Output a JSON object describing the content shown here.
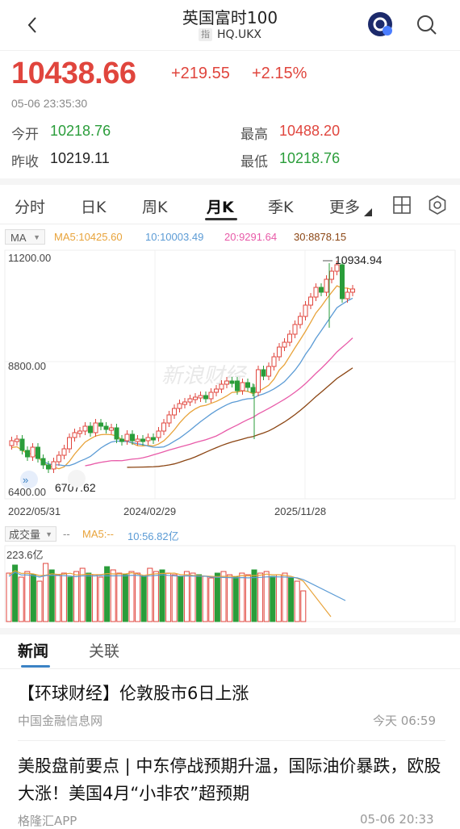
{
  "header": {
    "title": "英国富时100",
    "tag": "指",
    "code": "HQ.UKX"
  },
  "quote": {
    "price": "10438.66",
    "change": "+219.55",
    "change_pct": "+2.15%",
    "time": "05-06 23:35:30",
    "open_label": "今开",
    "open": "10218.76",
    "high_label": "最高",
    "high": "10488.20",
    "prev_label": "昨收",
    "prev": "10219.11",
    "low_label": "最低",
    "low": "10218.76"
  },
  "tabs": [
    "分时",
    "日K",
    "周K",
    "月K",
    "季K",
    "更多"
  ],
  "active_tab": "月K",
  "ma": {
    "button": "MA",
    "ma5": "MA5:10425.60",
    "ma10": "10:10003.49",
    "ma20": "20:9291.64",
    "ma30": "30:8878.15"
  },
  "chart_data": {
    "type": "candlestick",
    "y_ticks": [
      "11200.00",
      "8800.00",
      "6400.00"
    ],
    "x_ticks": [
      "2022/05/31",
      "2024/02/29",
      "2025/11/28"
    ],
    "max_label": "10934.94",
    "min_label": "6707.62",
    "watermark": "新浪财经",
    "ylim": [
      6400,
      11200
    ],
    "colors": {
      "up": "#e0453d",
      "down": "#2a9d3a",
      "ma5": "#e8a33a",
      "ma10": "#5b9bd5",
      "ma20": "#e85aa8",
      "ma30": "#8b4513"
    }
  },
  "volume": {
    "button": "成交量",
    "dash": "--",
    "ma5": "MA5:--",
    "ma10": "10:56.82亿",
    "max_label": "223.6亿"
  },
  "news_tabs": [
    "新闻",
    "关联"
  ],
  "news": [
    {
      "title": "【环球财经】伦敦股市6日上涨",
      "source": "中国金融信息网",
      "time": "今天 06:59"
    },
    {
      "title": "美股盘前要点 | 中东停战预期升温，国际油价暴跌，欧股大涨！美国4月“小非农”超预期",
      "source": "格隆汇APP",
      "time": "05-06 20:33"
    }
  ]
}
